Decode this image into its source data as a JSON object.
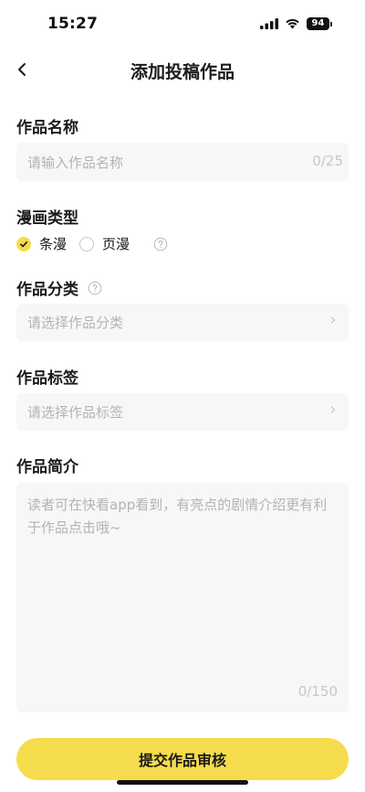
{
  "status_bar": {
    "time": "15:27",
    "battery": "94"
  },
  "nav": {
    "title": "添加投稿作品"
  },
  "work_name": {
    "label": "作品名称",
    "placeholder": "请输入作品名称",
    "counter": "0/25"
  },
  "comic_type": {
    "label": "漫画类型",
    "options": [
      {
        "label": "条漫",
        "checked": true
      },
      {
        "label": "页漫",
        "checked": false
      }
    ]
  },
  "category": {
    "label": "作品分类",
    "placeholder": "请选择作品分类"
  },
  "tags": {
    "label": "作品标签",
    "placeholder": "请选择作品标签"
  },
  "intro": {
    "label": "作品简介",
    "placeholder": "读者可在快看app看到，有亮点的剧情介绍更有利于作品点击哦~",
    "counter": "0/150"
  },
  "submit": {
    "label": "提交作品审核"
  },
  "colors": {
    "accent": "#f5dc4c",
    "field_bg": "#f7f7f7",
    "placeholder": "#b3b3b3"
  },
  "icons": [
    "back-chevron-icon",
    "help-icon",
    "chevron-right-icon",
    "check-icon",
    "signal-icon",
    "wifi-icon",
    "battery-icon"
  ]
}
